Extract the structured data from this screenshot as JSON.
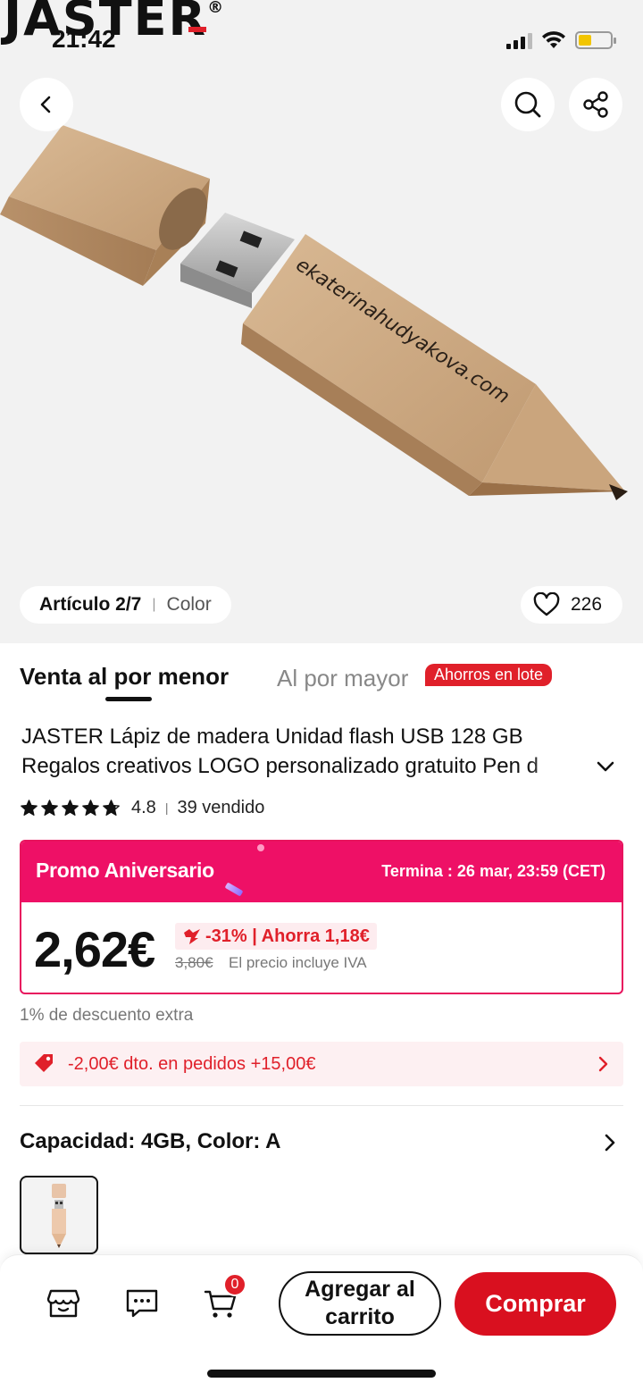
{
  "status_bar": {
    "time": "21:42",
    "battery_color": "#f2c500"
  },
  "header": {
    "brand_logo_text": "JASTER",
    "back_icon": "chevron-left-icon",
    "search_icon": "search-icon",
    "share_icon": "share-icon"
  },
  "gallery": {
    "image_watermark": "ekaterinahudyakova.com",
    "article_label": "Artículo 2/7",
    "color_label": "Color",
    "likes_count": "226"
  },
  "tabs": {
    "retail": "Venta al por menor",
    "wholesale": "Al por mayor",
    "lot_badge": "Ahorros en lote"
  },
  "product": {
    "title_line1": "JASTER Lápiz de madera Unidad flash USB 128 GB",
    "title_line2": "Regalos creativos LOGO personalizado gratuito Pen d",
    "rating": "4.8",
    "rating_stars": 4.8,
    "sold": "39 vendido"
  },
  "promo": {
    "title": "Promo Aniversario",
    "ends": "Termina : 26 mar, 23:59 (CET)",
    "price": "2,62€",
    "discount": "-31% | Ahorra 1,18€",
    "old_price": "3,80€",
    "vat_note": "El precio incluye IVA",
    "accent_color": "#ee1066"
  },
  "extra_discount": "1% de descuento extra",
  "coupon": {
    "text": "-2,00€ dto. en pedidos +15,00€"
  },
  "variant": {
    "capacity_label": "Capacidad: 4GB, Color: A"
  },
  "bottom_bar": {
    "cart_count": "0",
    "add_to_cart": "Agregar al carrito",
    "buy": "Comprar",
    "buy_color": "#d9101f"
  }
}
